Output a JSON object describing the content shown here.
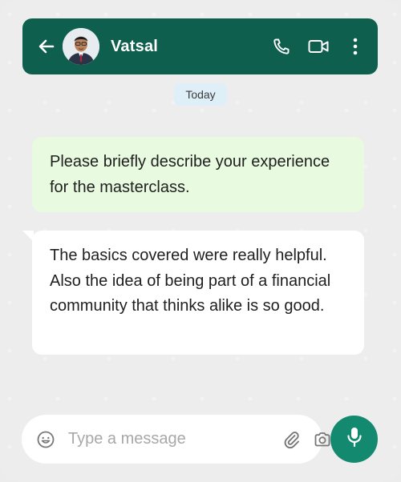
{
  "header": {
    "contact_name": "Vatsal",
    "icons": {
      "back": "arrow-left-icon",
      "avatar": "profile-photo",
      "call": "phone-icon",
      "video": "video-camera-icon",
      "menu": "more-vertical-icon"
    }
  },
  "date_divider": "Today",
  "messages": [
    {
      "direction": "outgoing",
      "text": "Please briefly describe your experience for the masterclass."
    },
    {
      "direction": "incoming",
      "text": "The basics covered were really helpful. Also the idea of being part of a financial community that thinks alike is so good."
    }
  ],
  "composer": {
    "placeholder": "Type a message",
    "value": "",
    "icons": {
      "emoji": "emoji-icon",
      "attach": "paperclip-icon",
      "camera": "camera-icon",
      "send": "microphone-icon"
    }
  },
  "colors": {
    "header_bg": "#0f5f4f",
    "outgoing_bubble": "#e8fbe0",
    "incoming_bubble": "#ffffff",
    "date_chip": "#dfeff8",
    "mic_button": "#138a70"
  }
}
